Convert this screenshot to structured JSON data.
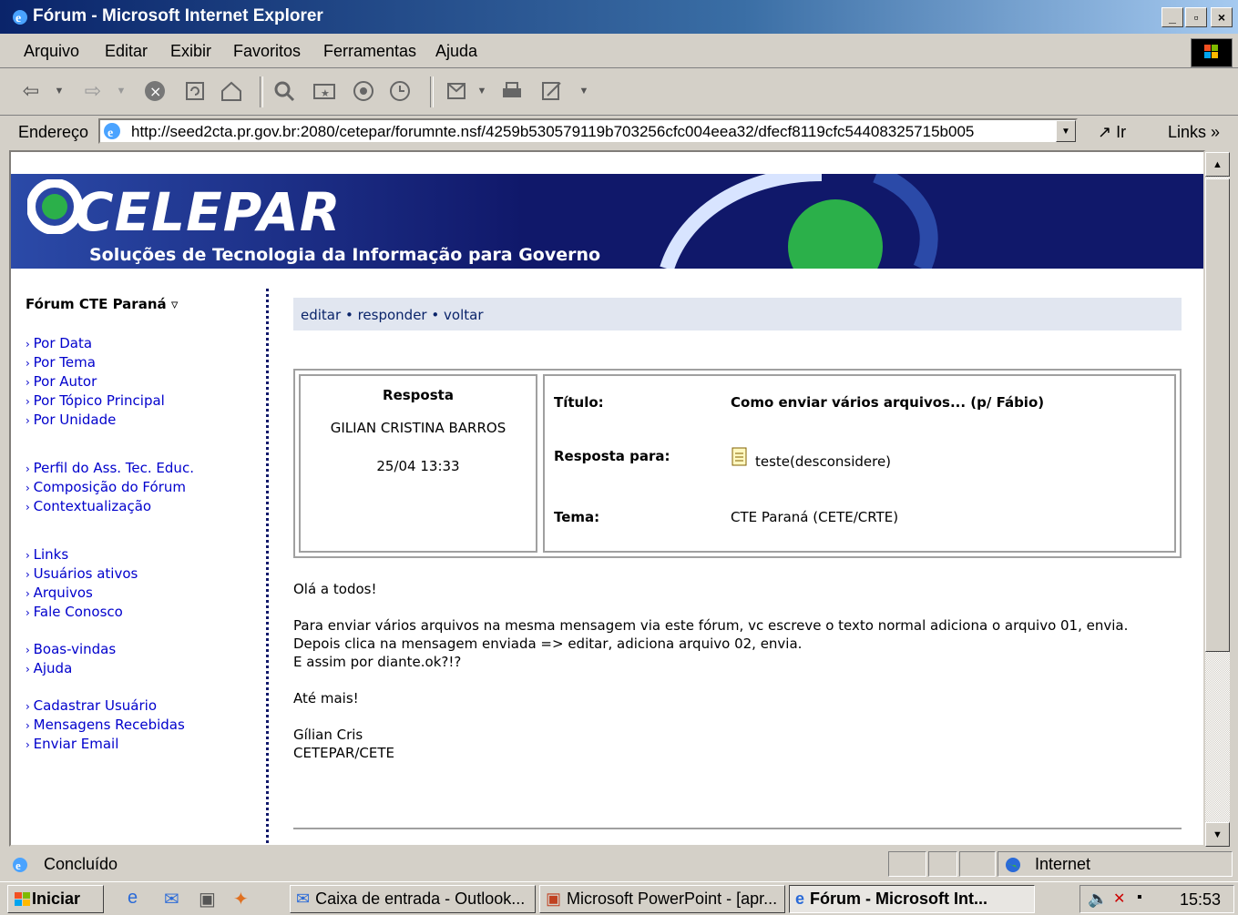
{
  "window": {
    "title": "Fórum - Microsoft Internet Explorer",
    "btn_min": "_",
    "btn_max": "▫",
    "btn_close": "×"
  },
  "menu": [
    "Arquivo",
    "Editar",
    "Exibir",
    "Favoritos",
    "Ferramentas",
    "Ajuda"
  ],
  "address": {
    "label": "Endereço",
    "url": "http://seed2cta.pr.gov.br:2080/cetepar/forumnte.nsf/4259b530579119b703256cfc004eea32/dfecf8119cfc54408325715b005",
    "go": "Ir",
    "links": "Links »"
  },
  "banner": {
    "logo": "CELEPAR",
    "subtitle": "Soluções de Tecnologia da Informação para Governo"
  },
  "sidebar": {
    "title": "Fórum CTE Paraná ▿",
    "group1": [
      "Por Data",
      "Por Tema",
      "Por Autor",
      "Por Tópico Principal",
      "Por Unidade"
    ],
    "group2": [
      "Perfil do Ass. Tec. Educ.",
      "Composição do Fórum",
      "Contextualização"
    ],
    "group3": [
      "Links",
      "Usuários ativos",
      "Arquivos",
      "Fale Conosco"
    ],
    "group4": [
      "Boas-vindas",
      "Ajuda"
    ],
    "group5": [
      "Cadastrar Usuário",
      "Mensagens Recebidas",
      "Enviar Email"
    ]
  },
  "actions": {
    "edit": "editar",
    "reply": "responder",
    "back": "voltar",
    "sep": "•"
  },
  "post": {
    "type": "Resposta",
    "author": "GILIAN CRISTINA BARROS",
    "date": "25/04 13:33",
    "title_label": "Título:",
    "title_value": "Como enviar vários arquivos... (p/ Fábio)",
    "reply_label": "Resposta para:",
    "reply_value": "teste(desconsidere)",
    "theme_label": "Tema:",
    "theme_value": "CTE Paraná (CETE/CRTE)"
  },
  "message": {
    "greeting": "Olá a todos!",
    "line1": "Para enviar vários arquivos na mesma mensagem via este fórum, vc escreve o texto normal adiciona o arquivo 01, envia.",
    "line2": "Depois clica na mensagem enviada => editar, adiciona arquivo 02, envia.",
    "line3": "E assim por diante.ok?!?",
    "closing": "Até mais!",
    "sig1": "Gílian Cris",
    "sig2": "CETEPAR/CETE"
  },
  "status": {
    "text": "Concluído",
    "zone": "Internet"
  },
  "taskbar": {
    "start": "Iniciar",
    "tasks": [
      "Caixa de entrada - Outlook...",
      "Microsoft PowerPoint - [apr...",
      "Fórum - Microsoft Int..."
    ],
    "clock": "15:53"
  },
  "colors": {
    "banner": "#10186a",
    "link": "#0000cc",
    "actionbar": "#e1e6f0"
  }
}
